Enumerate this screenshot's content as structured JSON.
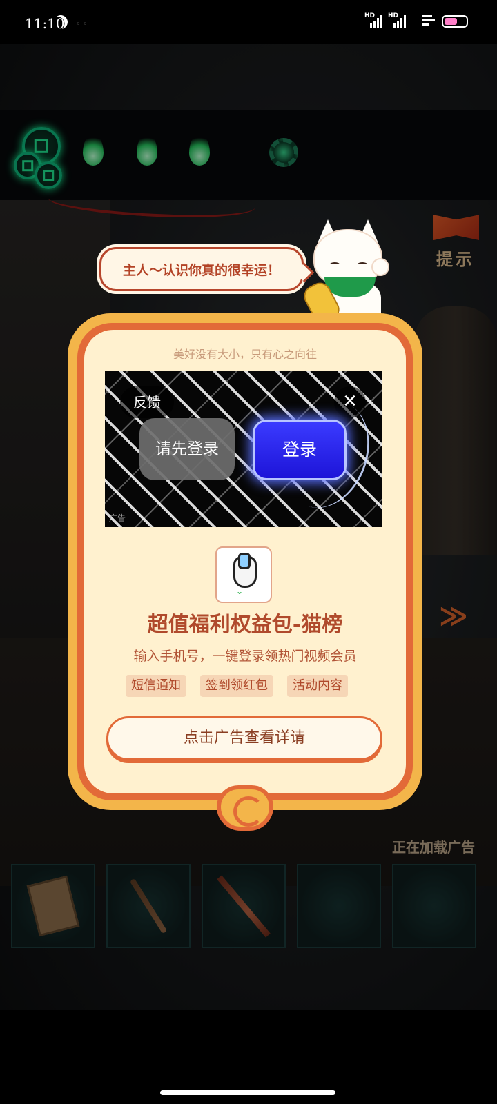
{
  "status_bar": {
    "time": "11:10",
    "network_labels": [
      "HD",
      "HD"
    ],
    "battery_color": "#ff7ec8"
  },
  "game": {
    "hint_label": "提示",
    "loading_text": "正在加载广告",
    "inventory": [
      {
        "icon": "book-item-icon"
      },
      {
        "icon": "wooden-stick-icon"
      },
      {
        "icon": "sword-icon"
      },
      {
        "icon": "empty-slot"
      },
      {
        "icon": "empty-slot"
      }
    ]
  },
  "cat_bubble": {
    "text": "主人～认识你真的很幸运！"
  },
  "dialog": {
    "tagline": "美好没有大小，只有心之向往",
    "ad": {
      "feedback_label": "反馈",
      "close_label": "✕",
      "pre_login_label": "请先登录",
      "login_label": "登录",
      "ad_tag": "广告"
    },
    "title": "超值福利权益包-猫榜",
    "subtitle": "输入手机号，一键登录领热门视频会员",
    "tags": [
      "短信通知",
      "签到领红包",
      "活动内容"
    ],
    "cta_label": "点击广告查看详请"
  },
  "colors": {
    "dialog_outer": "#f3b54a",
    "dialog_border": "#e26a38",
    "dialog_inner": "#fff1cf",
    "title_text": "#b04a2c",
    "login_button": "#1d14d8"
  }
}
